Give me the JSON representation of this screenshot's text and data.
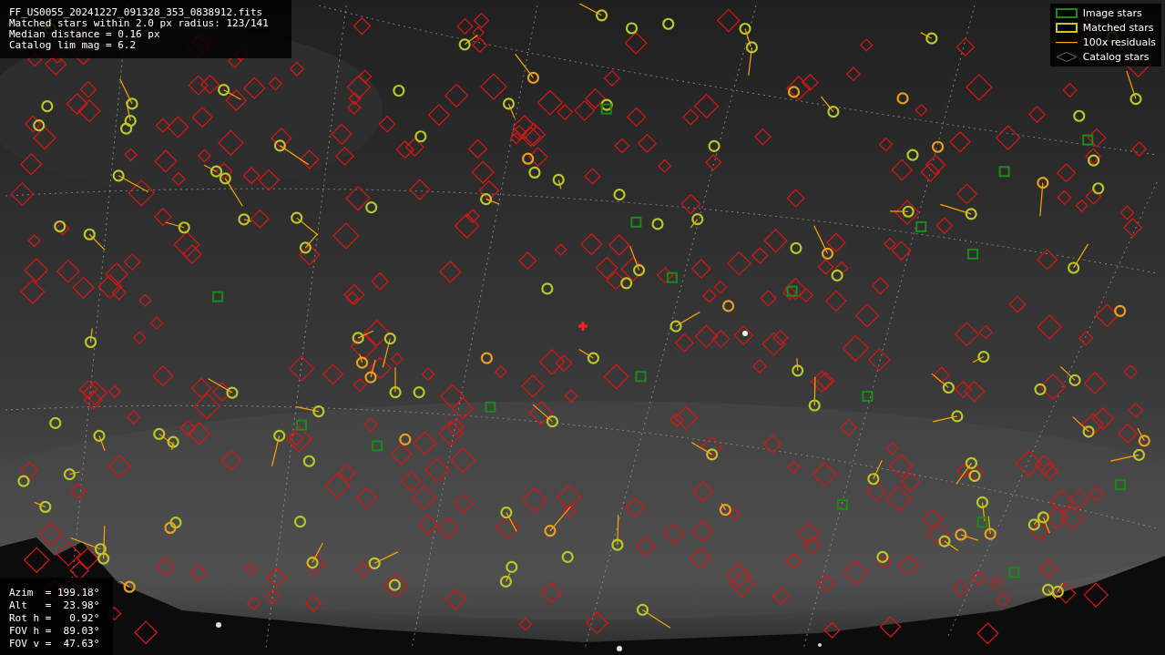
{
  "info": {
    "lines": [
      "FF_US0055_20241227_091328_353_0838912.fits",
      "Matched stars within 2.0 px radius: 123/141",
      "Median distance = 0.16 px",
      "Catalog lim mag = 6.2"
    ]
  },
  "legend": [
    {
      "label": "Image stars"
    },
    {
      "kind": "matched",
      "label": "Matched stars"
    },
    {
      "kind": "residual",
      "label": "100x residuals"
    },
    {
      "kind": "catalog",
      "label": "Catalog stars"
    }
  ],
  "pointing": {
    "lines": [
      "Azim  = 199.18°",
      "Alt   =  23.98°",
      "Rot h =   0.92°",
      "FOV h =  89.03°",
      "FOV v =  47.63°"
    ]
  }
}
